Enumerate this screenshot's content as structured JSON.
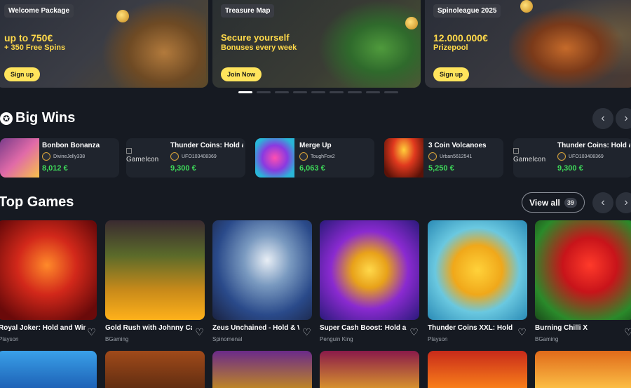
{
  "banners": [
    {
      "tag": "Welcome Package",
      "line1": "up to 750€",
      "line2": "+ 350 Free Spins",
      "cta": "Sign up"
    },
    {
      "tag": "Treasure Map",
      "line1": "Secure yourself",
      "line2": "Bonuses every week",
      "cta": "Join Now"
    },
    {
      "tag": "Spinoleague 2025",
      "line1": "12.000.000€",
      "line2": "Prizepool",
      "cta": "Sign up"
    }
  ],
  "carousel_dot_count": 9,
  "big_wins": {
    "title": "Big Wins",
    "items": [
      {
        "game": "Bonbon Bonanza",
        "user": "DivineJelly338",
        "amount": "8,012 €",
        "broken": ""
      },
      {
        "game": "Thunder Coins: Hold a",
        "user": "UFO103408369",
        "amount": "9,300 €",
        "broken": "GameIcon"
      },
      {
        "game": "Merge Up",
        "user": "ToughFox2",
        "amount": "6,063 €",
        "broken": ""
      },
      {
        "game": "3 Coin Volcanoes",
        "user": "Urban5612541",
        "amount": "5,250 €",
        "broken": ""
      },
      {
        "game": "Thunder Coins: Hold a",
        "user": "UFO103408369",
        "amount": "9,300 €",
        "broken": "GameIcon"
      }
    ]
  },
  "top_games": {
    "title": "Top Games",
    "view_all": "View all",
    "count": "39",
    "items": [
      {
        "name": "Royal Joker: Hold and Win",
        "provider": "Playson"
      },
      {
        "name": "Gold Rush with Johnny Cash",
        "provider": "BGaming"
      },
      {
        "name": "Zeus Unchained - Hold & Win",
        "provider": "Spinomenal"
      },
      {
        "name": "Super Cash Boost: Hold and Win",
        "provider": "Penguin King"
      },
      {
        "name": "Thunder Coins XXL: Hold and Win",
        "provider": "Playson"
      },
      {
        "name": "Burning Chilli X",
        "provider": "BGaming"
      }
    ]
  },
  "colors": {
    "background": "#161a22",
    "accent_yellow": "#ffe45c",
    "win_green": "#3edb5a"
  }
}
